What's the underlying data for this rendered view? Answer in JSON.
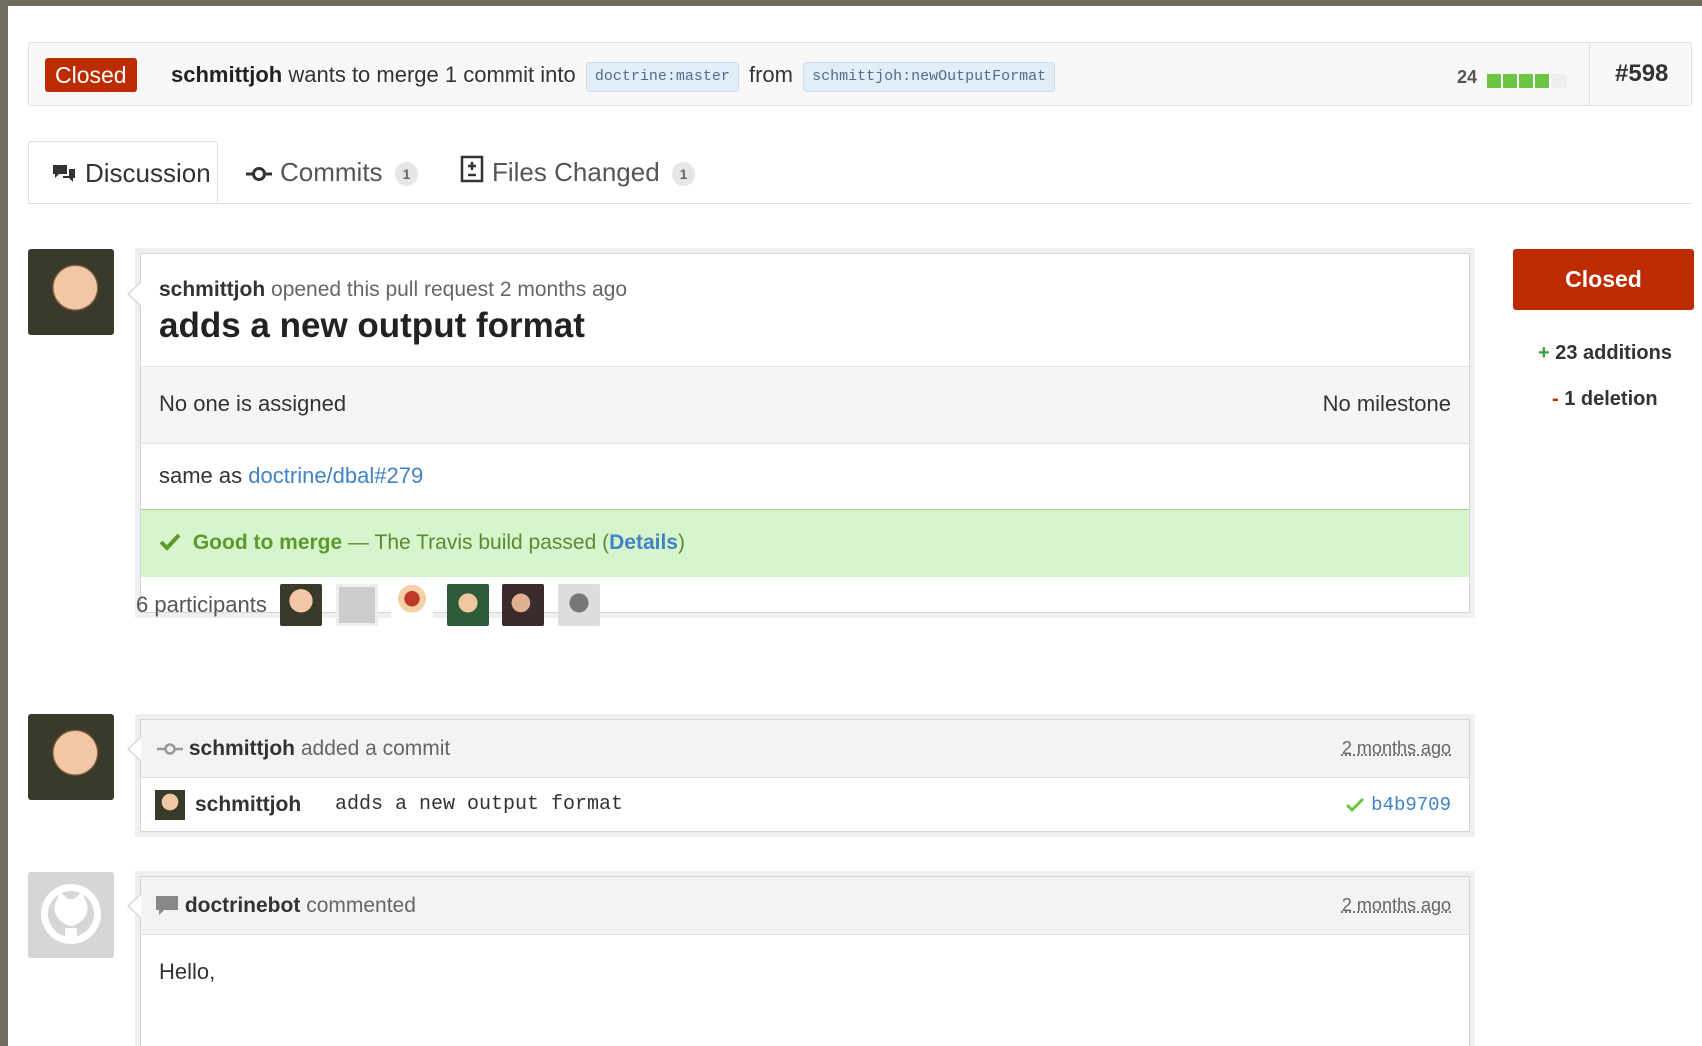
{
  "header": {
    "state": "Closed",
    "author": "schmittjoh",
    "merge_text": "wants to merge 1 commit into",
    "base_branch": "doctrine:master",
    "from_text": "from",
    "head_branch": "schmittjoh:newOutputFormat",
    "progress_count": "24",
    "progress_fraction": 0.8,
    "pr_number": "#598"
  },
  "tabs": [
    {
      "label": "Discussion",
      "icon": "discussion-icon"
    },
    {
      "label": "Commits",
      "count": "1",
      "icon": "commit-icon"
    },
    {
      "label": "Files Changed",
      "count": "1",
      "icon": "file-diff-icon"
    }
  ],
  "pr": {
    "author": "schmittjoh",
    "opened_text": "opened this pull request 2 months ago",
    "title": "adds a new output format",
    "assignee": "No one is assigned",
    "milestone": "No milestone",
    "body_prefix": "same as",
    "body_link": "doctrine/dbal#279",
    "merge_status_bold": "Good to merge",
    "merge_status_text": "— The Travis build passed (",
    "merge_status_link": "Details",
    "merge_status_close": ")"
  },
  "participants": {
    "label": "6 participants",
    "avatars": [
      "schmittjoh",
      "doctrinebot",
      "mario",
      "user4",
      "user5",
      "user6"
    ]
  },
  "sidebar": {
    "state_button": "Closed",
    "additions_sign": "+",
    "additions": "23 additions",
    "deletions_sign": "-",
    "deletions": "1 deletion"
  },
  "commit_event": {
    "author": "schmittjoh",
    "action": "added a commit",
    "time": "2 months ago",
    "commit_author": "schmittjoh",
    "message": "adds a new output format",
    "sha": "b4b9709"
  },
  "comment_event": {
    "author": "doctrinebot",
    "action": "commented",
    "time": "2 months ago",
    "body_first_line": "Hello,"
  },
  "colors": {
    "closed_red": "#bd2c00",
    "link_blue": "#4183c4",
    "success_green": "#6cc644",
    "merge_bg": "#d6f5cd"
  }
}
